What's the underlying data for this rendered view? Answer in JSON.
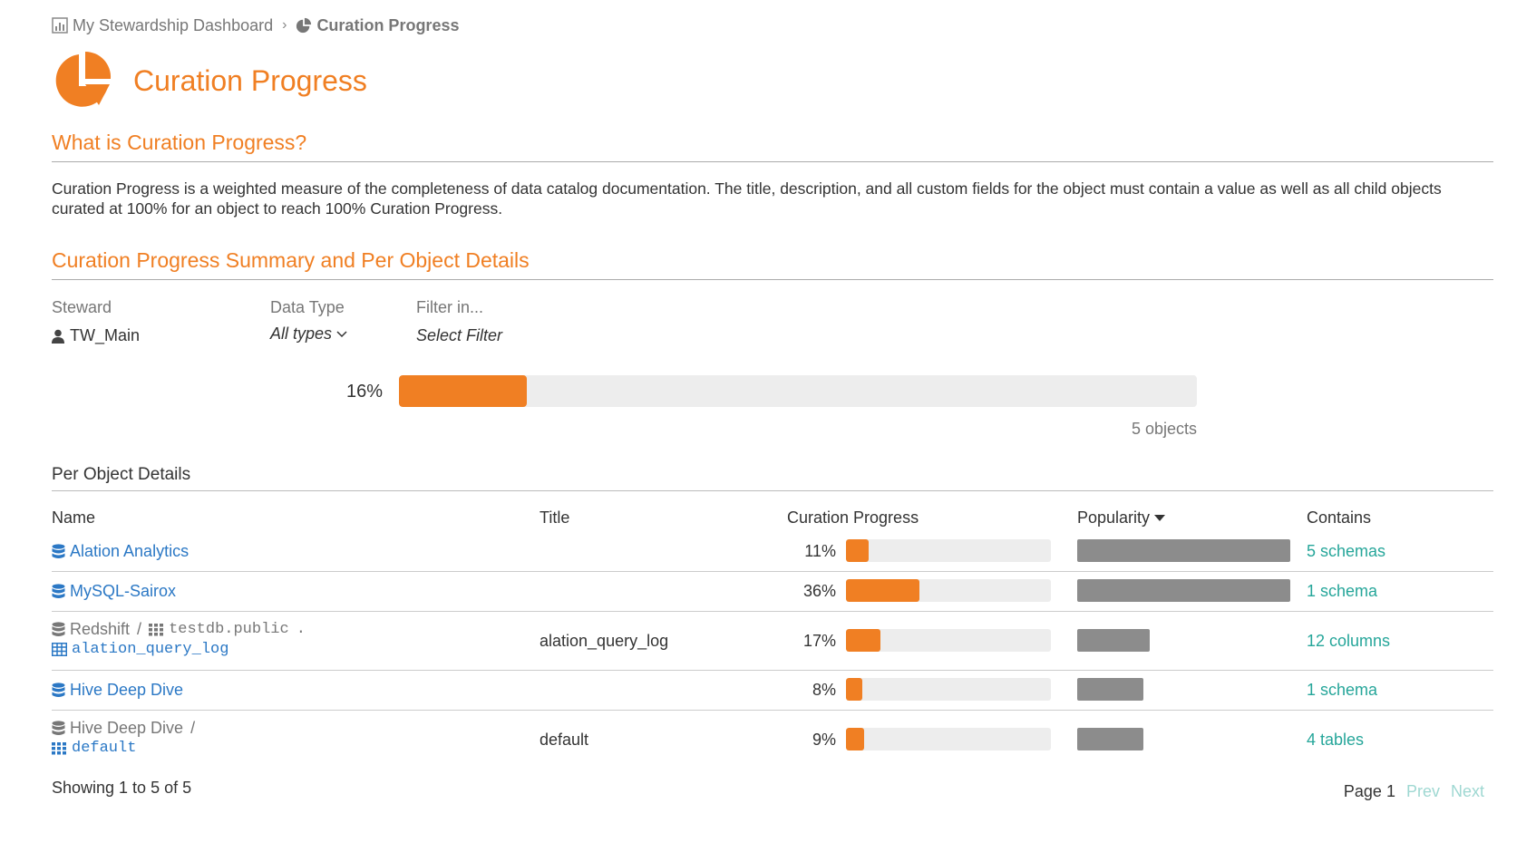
{
  "breadcrumb": {
    "parent": "My Stewardship Dashboard",
    "current": "Curation Progress"
  },
  "page": {
    "title": "Curation Progress"
  },
  "what_section": {
    "title": "What is Curation Progress?",
    "description": "Curation Progress is a weighted measure of the completeness of data catalog documentation. The title, description, and all custom fields for the object must contain a value as well as all child objects curated at 100% for an object to reach 100% Curation Progress."
  },
  "summary_section": {
    "title": "Curation Progress Summary and Per Object Details",
    "filters": {
      "steward_label": "Steward",
      "steward_value": "TW_Main",
      "datatype_label": "Data Type",
      "datatype_value": "All types",
      "filterin_label": "Filter in...",
      "filterin_value": "Select Filter"
    },
    "overall_pct_label": "16%",
    "overall_pct": 16,
    "objects_count": "5 objects"
  },
  "details": {
    "title": "Per Object Details",
    "headers": {
      "name": "Name",
      "title": "Title",
      "progress": "Curation Progress",
      "popularity": "Popularity",
      "contains": "Contains"
    },
    "rows": [
      {
        "name": "Alation Analytics",
        "title": "",
        "pct_label": "11%",
        "pct": 11,
        "popularity": 100,
        "contains": "5 schemas"
      },
      {
        "name": "MySQL-Sairox",
        "title": "",
        "pct_label": "36%",
        "pct": 36,
        "popularity": 100,
        "contains": "1 schema"
      },
      {
        "path_source": "Redshift",
        "path_schema": "testdb.public",
        "path_dot": ".",
        "name": "alation_query_log",
        "title": "alation_query_log",
        "pct_label": "17%",
        "pct": 17,
        "popularity": 34,
        "contains": "12 columns"
      },
      {
        "name": "Hive Deep Dive",
        "title": "",
        "pct_label": "8%",
        "pct": 8,
        "popularity": 31,
        "contains": "1 schema"
      },
      {
        "path_source": "Hive Deep Dive",
        "name": "default",
        "title": "default",
        "pct_label": "9%",
        "pct": 9,
        "popularity": 31,
        "contains": "4 tables"
      }
    ],
    "showing": "Showing 1 to 5 of 5",
    "pager": {
      "page": "Page 1",
      "prev": "Prev",
      "next": "Next"
    }
  },
  "colors": {
    "accent": "#f07f23",
    "link": "#2b78c5",
    "teal": "#26a69a",
    "popularity": "#8c8c8c"
  }
}
